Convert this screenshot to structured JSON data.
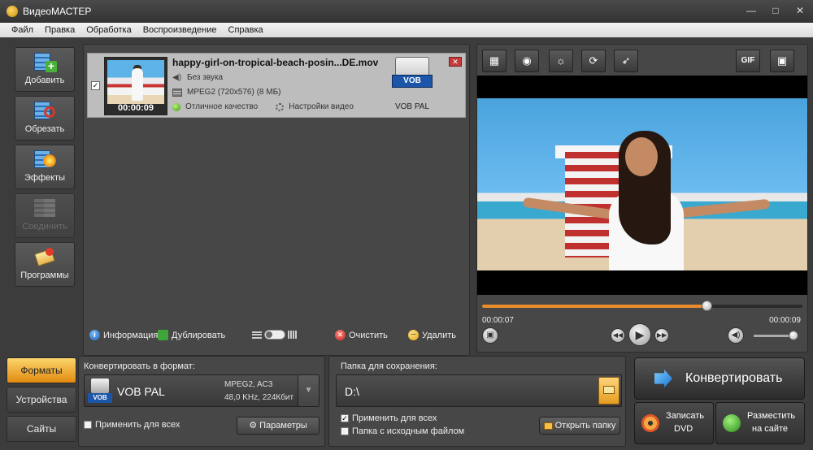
{
  "window": {
    "title": "ВидеоМАСТЕР",
    "minimize": "—",
    "maximize": "□",
    "close": "✕"
  },
  "menu": [
    "Файл",
    "Правка",
    "Обработка",
    "Воспроизведение",
    "Справка"
  ],
  "tools": [
    {
      "label": "Добавить",
      "icon": "add-film-icon"
    },
    {
      "label": "Обрезать",
      "icon": "cut-film-icon"
    },
    {
      "label": "Эффекты",
      "icon": "effects-icon"
    },
    {
      "label": "Соединить",
      "icon": "join-icon"
    },
    {
      "label": "Программы",
      "icon": "programs-icon"
    }
  ],
  "file": {
    "checked": "✓",
    "name": "happy-girl-on-tropical-beach-posin...DE.mov",
    "duration": "00:00:09",
    "audio": "Без звука",
    "video": "MPEG2 (720x576) (8 МБ)",
    "quality": "Отличное качество",
    "settings": "Настройки видео",
    "format_tag": "VOB",
    "format_label": "VOB PAL",
    "remove": "✕"
  },
  "list_toolbar": {
    "info": "Информация",
    "duplicate": "Дублировать",
    "clear": "Очистить",
    "delete": "Удалить"
  },
  "player": {
    "tools": [
      "crop-icon",
      "snapshot-icon",
      "brightness-icon",
      "rotate-icon",
      "speed-icon"
    ],
    "gif": "GIF",
    "current_time": "00:00:07",
    "total_time": "00:00:09",
    "progress": 0.7,
    "volume": 0.95
  },
  "tabs": [
    "Форматы",
    "Устройства",
    "Сайты"
  ],
  "format": {
    "heading": "Конвертировать в формат:",
    "tag": "VOB",
    "name": "VOB PAL",
    "codec": "MPEG2, AC3",
    "audio": "48,0 KHz, 224Кбит",
    "apply_all": "Применить для всех",
    "params": "Параметры"
  },
  "save": {
    "heading": "Папка для сохранения:",
    "path": "D:\\",
    "apply_all": "Применить для всех",
    "apply_all_checked": "✓",
    "source_folder": "Папка с исходным файлом",
    "open_folder": "Открыть папку"
  },
  "actions": {
    "convert": "Конвертировать",
    "dvd_line1": "Записать",
    "dvd_line2": "DVD",
    "web_line1": "Разместить",
    "web_line2": "на сайте"
  }
}
